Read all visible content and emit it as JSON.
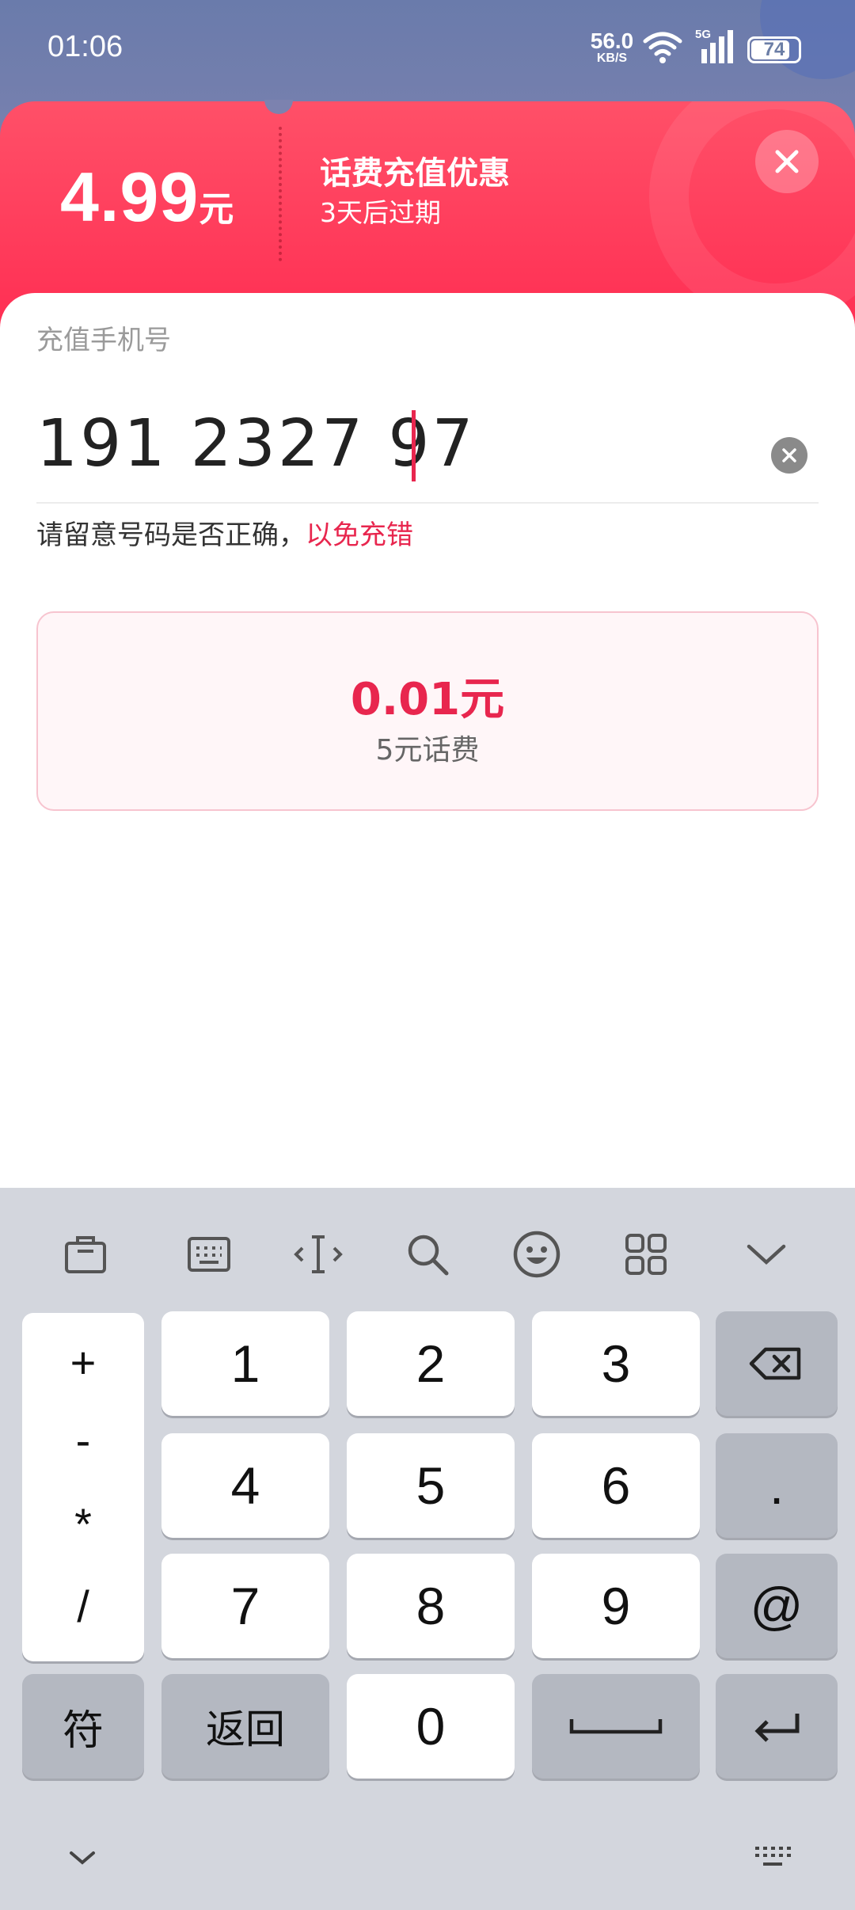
{
  "status_bar": {
    "time": "01:06",
    "net_speed_value": "56.0",
    "net_speed_unit": "KB/S",
    "network_type": "5G",
    "battery": "74"
  },
  "coupon": {
    "amount": "4.99",
    "unit": "元",
    "title": "话费充值优惠",
    "subtitle": "3天后过期"
  },
  "form": {
    "phone_label": "充值手机号",
    "phone_value": "191 2327 97",
    "hint_prefix": "请留意号码是否正确，",
    "hint_warning": "以免充错"
  },
  "options": [
    {
      "price": "0.01元",
      "desc": "5元话费"
    }
  ],
  "keyboard": {
    "toolbar_icons": [
      "clipboard-icon",
      "keyboard-icon",
      "cursor-move-icon",
      "search-icon",
      "emoji-icon",
      "grid-icon",
      "collapse-icon"
    ],
    "symbols": [
      "+",
      "-",
      "*",
      "/"
    ],
    "digits": [
      "1",
      "2",
      "3",
      "4",
      "5",
      "6",
      "7",
      "8",
      "9",
      "0"
    ],
    "dot": ".",
    "at": "@",
    "sym_label": "符",
    "back_label": "返回"
  },
  "colors": {
    "accent": "#e8264e",
    "coupon_bg": "#ff3a5a",
    "keyboard_bg": "#d3d6dd"
  }
}
